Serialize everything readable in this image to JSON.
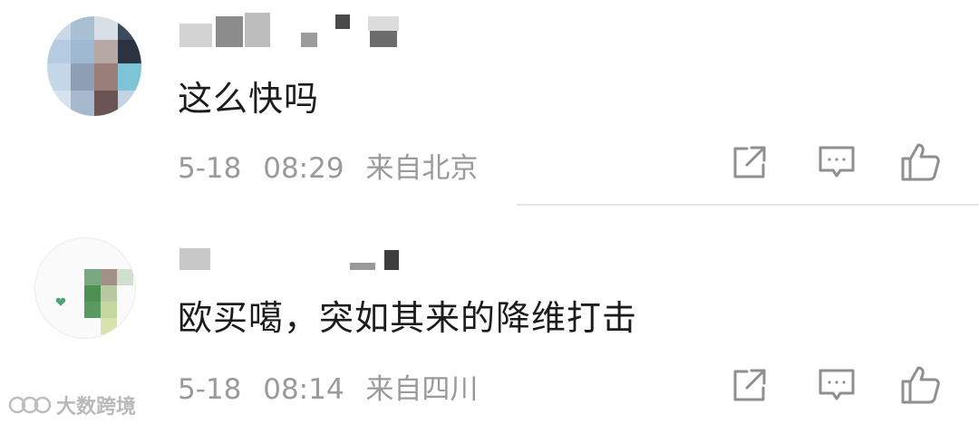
{
  "comments": [
    {
      "text": "这么快吗",
      "date": "5-18",
      "time": "08:29",
      "location": "来自北京"
    },
    {
      "text": "欧买噶，突如其来的降维打击",
      "date": "5-18",
      "time": "08:14",
      "location": "来自四川"
    }
  ],
  "icons": {
    "share": "share-icon",
    "comment": "comment-icon",
    "like": "thumbs-up-icon"
  },
  "colors": {
    "icon": "#8f8f8f",
    "meta_text": "#9a9a9a",
    "comment_text": "#1c1c1c"
  },
  "watermark": {
    "text": "大数跨境"
  }
}
